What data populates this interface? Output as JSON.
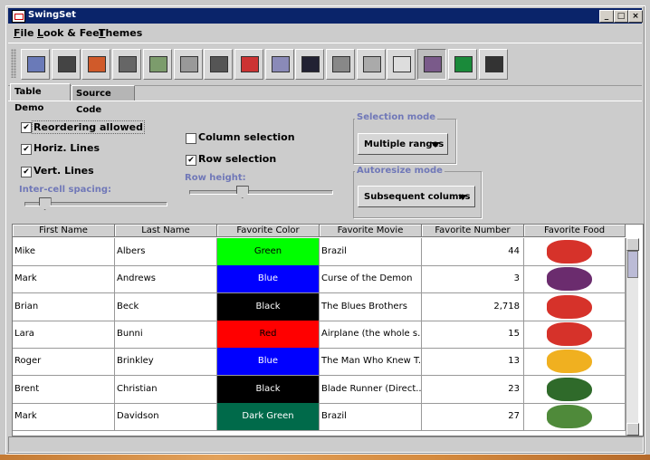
{
  "window": {
    "title": "SwingSet",
    "controls": [
      "_",
      "□",
      "×"
    ]
  },
  "menubar": {
    "items": [
      {
        "label": "File",
        "mnemonic": "F",
        "rest": "ile"
      },
      {
        "label": "Look & Feel",
        "mnemonic": "L",
        "rest": "ook & Feel"
      },
      {
        "label": "Themes",
        "mnemonic": "T",
        "rest": "hemes"
      }
    ]
  },
  "toolbar": {
    "buttons": [
      "internal-frame-icon",
      "radio-checkbox-icon",
      "color-chooser-icon",
      "combo-box-icon",
      "file-chooser-icon",
      "editor-pane-icon",
      "list-icon",
      "option-pane-icon",
      "progress-bar-icon",
      "scroll-pane-icon",
      "slider-icon",
      "split-pane-icon",
      "tabbed-pane-icon",
      "table-icon",
      "tooltip-icon",
      "tree-icon"
    ],
    "active_index": 13
  },
  "tabs": [
    {
      "label": "Table Demo",
      "selected": true
    },
    {
      "label": "Source Code",
      "selected": false
    }
  ],
  "options": {
    "reordering": {
      "label": "Reordering allowed",
      "checked": true
    },
    "horiz_lines": {
      "label": "Horiz. Lines",
      "checked": true
    },
    "vert_lines": {
      "label": "Vert. Lines",
      "checked": true
    },
    "intercell_label": "Inter-cell spacing:",
    "intercell_value": 0.1,
    "column_selection": {
      "label": "Column selection",
      "checked": false
    },
    "row_selection": {
      "label": "Row selection",
      "checked": true
    },
    "row_height_label": "Row height:",
    "row_height_value": 0.33
  },
  "selection_mode": {
    "title": "Selection mode",
    "value": "Multiple ranges"
  },
  "autoresize_mode": {
    "title": "Autoresize mode",
    "value": "Subsequent columns"
  },
  "table": {
    "headers": [
      "First Name",
      "Last Name",
      "Favorite Color",
      "Favorite Movie",
      "Favorite Number",
      "Favorite Food"
    ],
    "rows": [
      {
        "first": "Mike",
        "last": "Albers",
        "color": "Green",
        "color_hex": "#00ff00",
        "text_hex": "#000000",
        "movie": "Brazil",
        "number": "44",
        "food": "strawberry-icon"
      },
      {
        "first": "Mark",
        "last": "Andrews",
        "color": "Blue",
        "color_hex": "#0000ff",
        "text_hex": "#ffffff",
        "movie": "Curse of the Demon",
        "number": "3",
        "food": "grapes-icon"
      },
      {
        "first": "Brian",
        "last": "Beck",
        "color": "Black",
        "color_hex": "#000000",
        "text_hex": "#ffffff",
        "movie": "The Blues Brothers",
        "number": "2,718",
        "food": "strawberry-icon"
      },
      {
        "first": "Lara",
        "last": "Bunni",
        "color": "Red",
        "color_hex": "#ff0000",
        "text_hex": "#000000",
        "movie": "Airplane (the whole s...",
        "number": "15",
        "food": "strawberry-icon"
      },
      {
        "first": "Roger",
        "last": "Brinkley",
        "color": "Blue",
        "color_hex": "#0000ff",
        "text_hex": "#ffffff",
        "movie": "The Man Who Knew T...",
        "number": "13",
        "food": "peach-icon"
      },
      {
        "first": "Brent",
        "last": "Christian",
        "color": "Black",
        "color_hex": "#000000",
        "text_hex": "#ffffff",
        "movie": "Blade Runner (Direct...",
        "number": "23",
        "food": "broccoli-icon"
      },
      {
        "first": "Mark",
        "last": "Davidson",
        "color": "Dark Green",
        "color_hex": "#006a4a",
        "text_hex": "#ffffff",
        "movie": "Brazil",
        "number": "27",
        "food": "asparagus-icon"
      }
    ]
  }
}
